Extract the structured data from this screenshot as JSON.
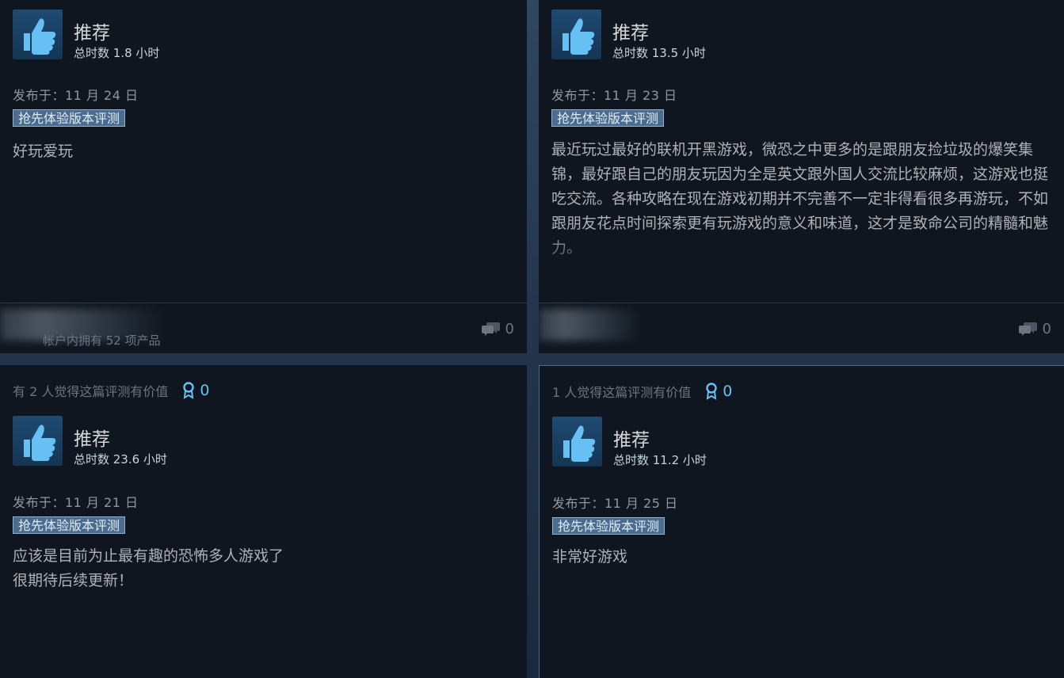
{
  "reviews": [
    {
      "id": "tl",
      "recommend_label": "推荐",
      "hours": "总时数 1.8 小时",
      "posted": "发布于：11 月 24 日",
      "badge": "抢先体验版本评测",
      "body": "好玩爱玩",
      "footer_products": "帐户内拥有 52 项产品",
      "comment_count": "0"
    },
    {
      "id": "tr",
      "recommend_label": "推荐",
      "hours": "总时数 13.5 小时",
      "posted": "发布于：11 月 23 日",
      "badge": "抢先体验版本评测",
      "body": "最近玩过最好的联机开黑游戏，微恐之中更多的是跟朋友捡垃圾的爆笑集锦，最好跟自己的朋友玩因为全是英文跟外国人交流比较麻烦，这游戏也挺吃交流。各种攻略在现在游戏初期并不完善不一定非得看很多再游玩，不如跟朋友花点时间探索更有玩游戏的意义和味道，这才是致命公司的精髓和魅力。",
      "comment_count": "0"
    },
    {
      "id": "bl",
      "helpful_text": "有 2 人觉得这篇评测有价值",
      "award_count": "0",
      "recommend_label": "推荐",
      "hours": "总时数 23.6 小时",
      "posted": "发布于：11 月 21 日",
      "badge": "抢先体验版本评测",
      "body_line1": "应该是目前为止最有趣的恐怖多人游戏了",
      "body_line2": "很期待后续更新！"
    },
    {
      "id": "br",
      "helpful_text": "1 人觉得这篇评测有价值",
      "award_count": "0",
      "recommend_label": "推荐",
      "hours": "总时数 11.2 小时",
      "posted": "发布于：11 月 25 日",
      "badge": "抢先体验版本评测",
      "body": "非常好游戏"
    }
  ],
  "icons": {
    "thumb": "thumbs-up-icon",
    "comment": "speech-bubbles-icon",
    "award": "award-ribbon-icon"
  },
  "colors": {
    "card_bg": "#0f1620",
    "accent": "#66c0f4",
    "badge_bg": "#4b6c8e"
  }
}
